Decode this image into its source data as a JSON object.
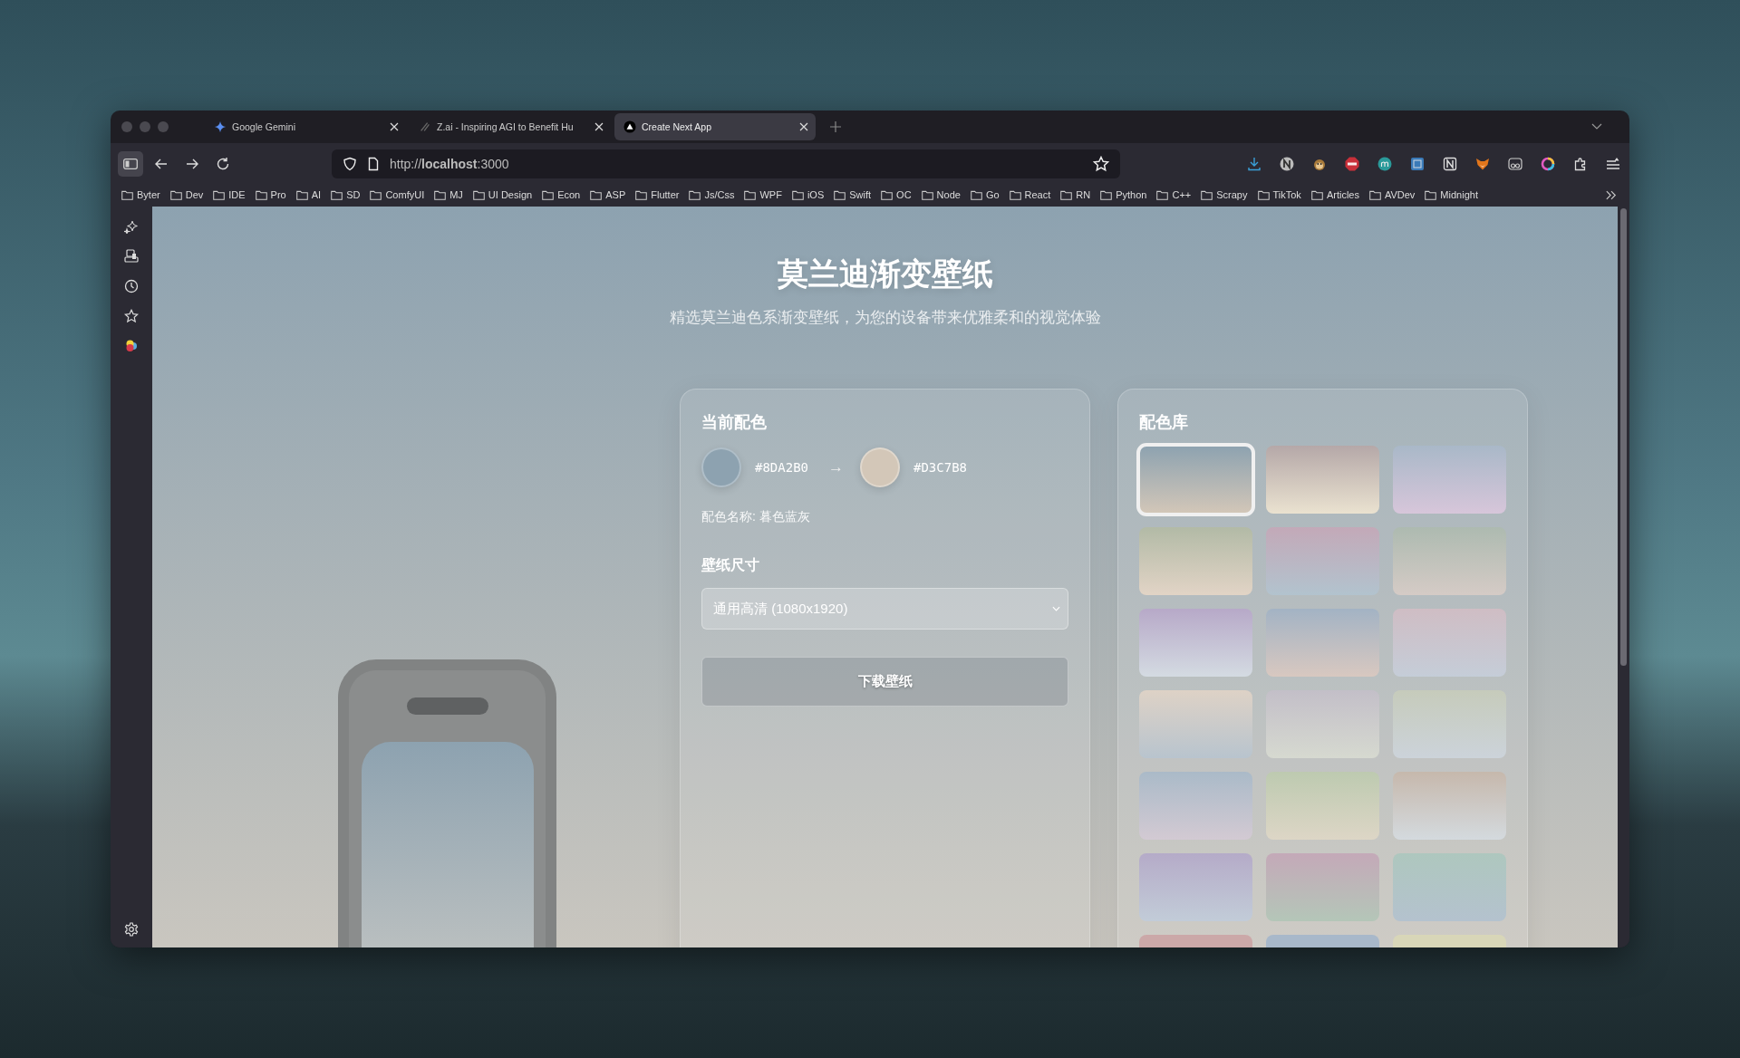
{
  "browser": {
    "tabs": [
      {
        "title": "Google Gemini",
        "selected": false
      },
      {
        "title": "Z.ai - Inspiring AGI to Benefit Hu",
        "selected": false
      },
      {
        "title": "Create Next App",
        "selected": true
      }
    ],
    "url": "http://**localhost**:3000",
    "bookmarks": [
      "Byter",
      "Dev",
      "IDE",
      "Pro",
      "AI",
      "SD",
      "ComfyUI",
      "MJ",
      "UI Design",
      "Econ",
      "ASP",
      "Flutter",
      "Js/Css",
      "WPF",
      "iOS",
      "Swift",
      "OC",
      "Node",
      "Go",
      "React",
      "RN",
      "Python",
      "C++",
      "Scrapy",
      "TikTok",
      "Articles",
      "AVDev",
      "Midnight"
    ]
  },
  "page": {
    "title": "莫兰迪渐变壁纸",
    "subtitle": "精选莫兰迪色系渐变壁纸，为您的设备带来优雅柔和的视觉体验"
  },
  "current": {
    "heading": "当前配色",
    "start_color": "#8DA2B0",
    "arrow": "→",
    "end_color": "#D3C7B8",
    "name_line": "配色名称: 暮色蓝灰",
    "size_label": "壁纸尺寸",
    "size_value": "通用高清 (1080x1920)",
    "download_button": "下载壁纸"
  },
  "palette": {
    "heading": "配色库",
    "swatches": [
      {
        "gradient": [
          {
            "color": "#8DA2B0"
          },
          {
            "color": "#D3C7B8"
          }
        ],
        "selected": true
      },
      {
        "gradient": [
          {
            "color": "#B5A8A8"
          },
          {
            "color": "#EAE2D0"
          }
        ],
        "selected": false
      },
      {
        "gradient": [
          {
            "color": "#A9B8C8"
          },
          {
            "color": "#D7C6DA"
          }
        ],
        "selected": false
      },
      {
        "gradient": [
          {
            "color": "#B2BAA6"
          },
          {
            "color": "#E2D4C6"
          }
        ],
        "selected": false
      },
      {
        "gradient": [
          {
            "color": "#C3A9B8"
          },
          {
            "color": "#B2C3CE"
          }
        ],
        "selected": false
      },
      {
        "gradient": [
          {
            "color": "#ADBAB0"
          },
          {
            "color": "#D5CBC6"
          }
        ],
        "selected": false
      },
      {
        "gradient": [
          {
            "color": "#B7A9C8"
          },
          {
            "color": "#D4DBE2"
          }
        ],
        "selected": false
      },
      {
        "gradient": [
          {
            "color": "#A3B3C4"
          },
          {
            "color": "#D8C8C0"
          }
        ],
        "selected": false
      },
      {
        "gradient": [
          {
            "color": "#CFBDC4"
          },
          {
            "color": "#C5CDD8"
          }
        ],
        "selected": false
      },
      {
        "gradient": [
          {
            "color": "#DED2C6"
          },
          {
            "color": "#B8C4CE"
          }
        ],
        "selected": false
      },
      {
        "gradient": [
          {
            "color": "#C3BFC8"
          },
          {
            "color": "#D6D9D0"
          }
        ],
        "selected": false
      },
      {
        "gradient": [
          {
            "color": "#C6CBBB"
          },
          {
            "color": "#CCD3DA"
          }
        ],
        "selected": false
      },
      {
        "gradient": [
          {
            "color": "#AABAC8"
          },
          {
            "color": "#D3CAD3"
          }
        ],
        "selected": false
      },
      {
        "gradient": [
          {
            "color": "#BDCAB0"
          },
          {
            "color": "#DDD6C6"
          }
        ],
        "selected": false
      },
      {
        "gradient": [
          {
            "color": "#C6B8AC"
          },
          {
            "color": "#D4DADE"
          }
        ],
        "selected": false
      },
      {
        "gradient": [
          {
            "color": "#B5ABC8"
          },
          {
            "color": "#C2CCD8"
          }
        ],
        "selected": false
      },
      {
        "gradient": [
          {
            "color": "#C4A9B8"
          },
          {
            "color": "#B4C6B8"
          }
        ],
        "selected": false
      },
      {
        "gradient": [
          {
            "color": "#AEC7BE"
          },
          {
            "color": "#B4C2CE"
          }
        ],
        "selected": false
      },
      {
        "gradient": [
          {
            "color": "#CBA8A8"
          }
        ],
        "selected": false
      },
      {
        "gradient": [
          {
            "color": "#A8B8CA"
          }
        ],
        "selected": false
      },
      {
        "gradient": [
          {
            "color": "#D8D6B8"
          }
        ],
        "selected": false
      }
    ]
  }
}
